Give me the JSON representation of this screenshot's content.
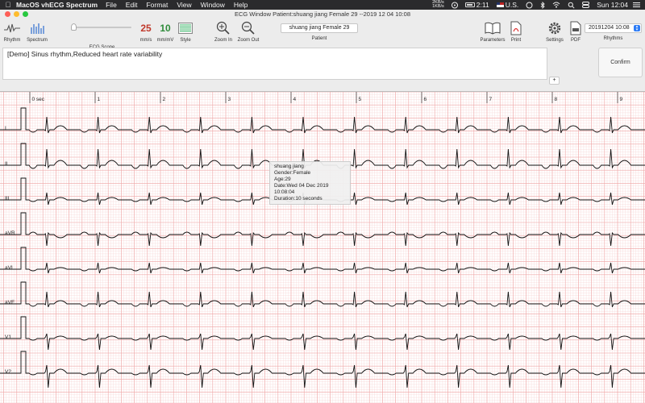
{
  "menubar": {
    "app_name": "MacOS vhECG Spectrum",
    "menus": [
      "File",
      "Edit",
      "Format",
      "View",
      "Window",
      "Help"
    ],
    "net_up": "2KB/s",
    "net_down": "1KB/s",
    "battery_time": "2:11",
    "input_source": "U.S.",
    "clock": "Sun 12:04"
  },
  "window": {
    "title": "ECG Window Patient:shuang jiang Female 29 --2019 12 04 10:08"
  },
  "toolbar": {
    "rhythm_label": "Rhythm",
    "spectrum_label": "Spectrum",
    "ecg_scope_label": "ECG Scope",
    "speed_value": "25",
    "speed_unit": "mm/s",
    "gain_value": "10",
    "gain_unit": "mm/mV",
    "style_label": "Style",
    "zoom_in_label": "Zoom In",
    "zoom_out_label": "Zoom Out",
    "patient_field_value": "shuang jiang Female 29",
    "patient_caption": "Patient",
    "parameters_label": "Parameters",
    "print_label": "Print",
    "settings_label": "Settings",
    "pdf_label": "PDF",
    "rhythm_select_value": "20191204 10:08",
    "rhythms_caption": "Rhythms"
  },
  "notes": {
    "diagnosis": "[Demo] Sinus rhythm,Reduced heart rate variability",
    "plus_label": "+",
    "confirm_label": "Confirm"
  },
  "ecg": {
    "time_labels": [
      "0 sec",
      "1",
      "2",
      "3",
      "4",
      "5",
      "6",
      "7",
      "8",
      "9"
    ],
    "leads": [
      "I",
      "II",
      "III",
      "aVR",
      "aVL",
      "aVF",
      "V1",
      "V2"
    ],
    "colors": {
      "grid_minor": "#f8d8d8",
      "grid_major": "#efa6a6",
      "trace": "#111111"
    }
  },
  "patient_info": {
    "name": "shuang jiang",
    "gender": "Gender:Female",
    "age": "Age:29",
    "date": "Date:Wed 04 Dec 2019 10:08:04",
    "duration": "Duration:10 seconds"
  }
}
